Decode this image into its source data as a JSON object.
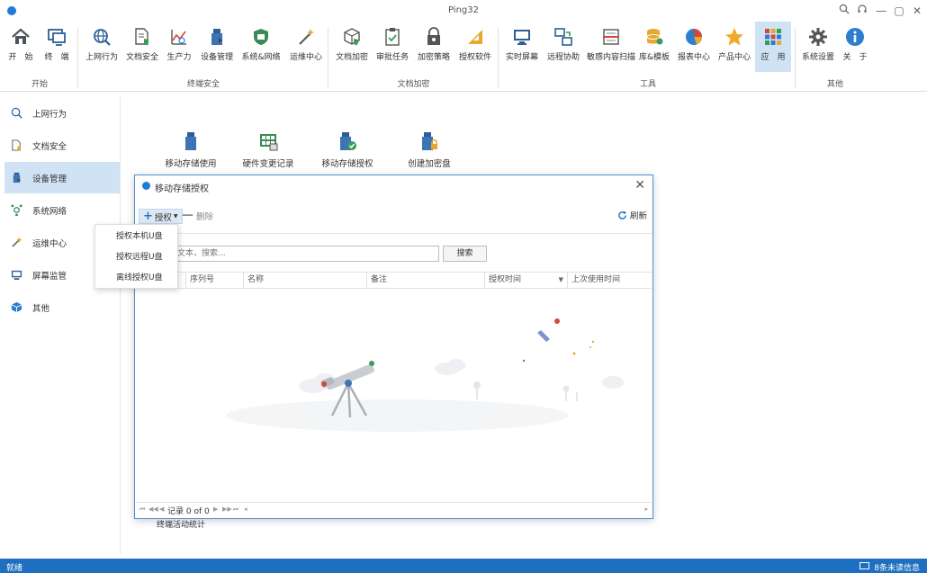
{
  "window": {
    "title": "Ping32",
    "controls": [
      "search-icon",
      "headset-icon",
      "minimize-icon",
      "maximize-icon",
      "close-icon"
    ]
  },
  "ribbon": {
    "groups": [
      {
        "label": "开始",
        "items": [
          {
            "label": "开　始",
            "icon": "home-icon"
          },
          {
            "label": "终　端",
            "icon": "monitor-icon"
          }
        ]
      },
      {
        "label": "终端安全",
        "items": [
          {
            "label": "上网行为",
            "icon": "globe-search-icon"
          },
          {
            "label": "文档安全",
            "icon": "doc-shield-icon"
          },
          {
            "label": "生产力",
            "icon": "productivity-chart-icon"
          },
          {
            "label": "设备管理",
            "icon": "usb-device-icon"
          },
          {
            "label": "系统&网络",
            "icon": "network-icon"
          },
          {
            "label": "运维中心",
            "icon": "magic-wand-icon"
          }
        ]
      },
      {
        "label": "文档加密",
        "items": [
          {
            "label": "文档加密",
            "icon": "cube-shield-icon"
          },
          {
            "label": "审批任务",
            "icon": "clipboard-check-icon"
          },
          {
            "label": "加密策略",
            "icon": "lock-icon"
          },
          {
            "label": "授权软件",
            "icon": "ruler-icon"
          }
        ]
      },
      {
        "label": "工具",
        "items": [
          {
            "label": "实时屏幕",
            "icon": "screen-icon"
          },
          {
            "label": "远程协助",
            "icon": "remote-assist-icon"
          },
          {
            "label": "敏感内容扫描",
            "icon": "scan-icon"
          },
          {
            "label": "库&模板",
            "icon": "database-icon"
          },
          {
            "label": "报表中心",
            "icon": "pie-chart-icon"
          },
          {
            "label": "产品中心",
            "icon": "star-icon"
          },
          {
            "label": "应　用",
            "icon": "apps-grid-icon"
          }
        ]
      },
      {
        "label": "其他",
        "items": [
          {
            "label": "系统设置",
            "icon": "gear-icon"
          },
          {
            "label": "关　于",
            "icon": "info-icon"
          }
        ]
      }
    ],
    "active_item": "应　用"
  },
  "sidebar": {
    "items": [
      {
        "label": "上网行为",
        "icon": "globe-search-icon"
      },
      {
        "label": "文档安全",
        "icon": "doc-shield-icon"
      },
      {
        "label": "设备管理",
        "icon": "usb-device-icon",
        "active": true
      },
      {
        "label": "系统网络",
        "icon": "network-icon"
      },
      {
        "label": "运维中心",
        "icon": "magic-wand-icon"
      },
      {
        "label": "屏幕监管",
        "icon": "screen-icon"
      },
      {
        "label": "其他",
        "icon": "cube-icon"
      }
    ]
  },
  "main": {
    "tools": [
      {
        "label": "移动存储使用",
        "icon": "usb-drive-icon"
      },
      {
        "label": "硬件变更记录",
        "icon": "hardware-grid-icon"
      },
      {
        "label": "移动存储授权",
        "icon": "usb-check-icon"
      },
      {
        "label": "创建加密盘",
        "icon": "usb-lock-icon"
      }
    ],
    "hidden_tool_label": "终端活动统计"
  },
  "dialog": {
    "title": "移动存储授权",
    "grant_label": "授权",
    "delete_label": "删除",
    "refresh_label": "刷新",
    "search_placeholder": "文本，搜索...",
    "search_button": "搜索",
    "columns": [
      "",
      "序列号",
      "名称",
      "备注",
      "授权时间",
      "上次使用时间"
    ],
    "pager_text": "记录 0 of 0"
  },
  "dropdown": {
    "items": [
      "授权本机U盘",
      "授权远程U盘",
      "离线授权U盘"
    ]
  },
  "statusbar": {
    "status": "就绪",
    "messages": "8条未读信息"
  },
  "colors": {
    "accent": "#1e6fbf",
    "active_bg": "#cfe3f5",
    "dialog_border": "#4a8fd3"
  }
}
